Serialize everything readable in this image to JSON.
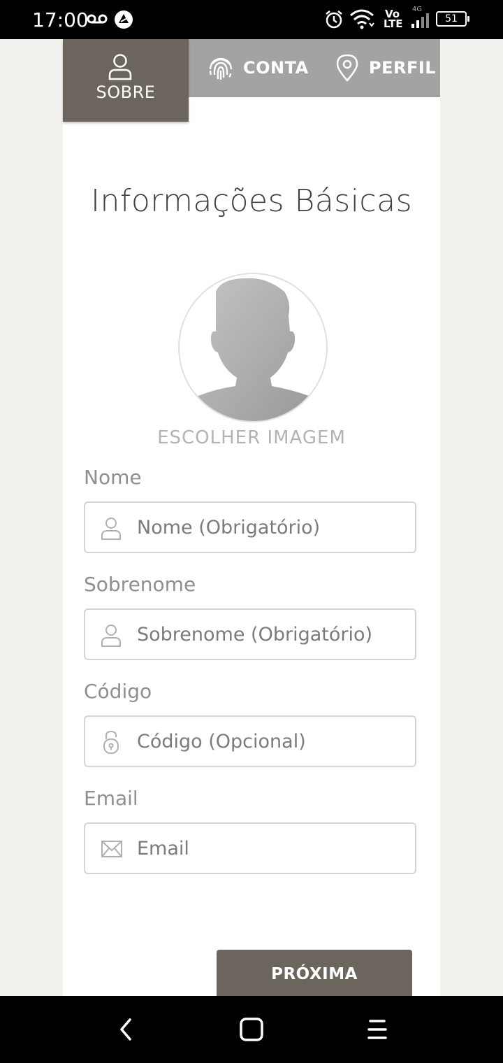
{
  "status_bar": {
    "time": "17:00",
    "network_vo": "Vo",
    "network_lte": "LTE",
    "network_gen": "4G",
    "battery": "51"
  },
  "tabs": [
    {
      "label": "SOBRE",
      "icon": "user-icon",
      "active": true
    },
    {
      "label": "CONTA",
      "icon": "fingerprint-icon",
      "active": false
    },
    {
      "label": "PERFIL",
      "icon": "location-pin-icon",
      "active": false
    }
  ],
  "form": {
    "title": "Informações Básicas",
    "choose_image": "ESCOLHER IMAGEM",
    "fields": [
      {
        "label": "Nome",
        "placeholder": "Nome (Obrigatório)",
        "value": "",
        "icon": "user-icon"
      },
      {
        "label": "Sobrenome",
        "placeholder": "Sobrenome (Obrigatório)",
        "value": "",
        "icon": "user-icon"
      },
      {
        "label": "Código",
        "placeholder": "Código (Opcional)",
        "value": "",
        "icon": "lock-icon"
      },
      {
        "label": "Email",
        "placeholder": "Email",
        "value": "",
        "icon": "envelope-icon"
      }
    ],
    "next_label": "PRÓXIMA"
  },
  "colors": {
    "tab_active": "#6b655d",
    "tab_inactive": "#a3a3a3",
    "button": "#6b655d",
    "background": "#f2f1ee"
  }
}
